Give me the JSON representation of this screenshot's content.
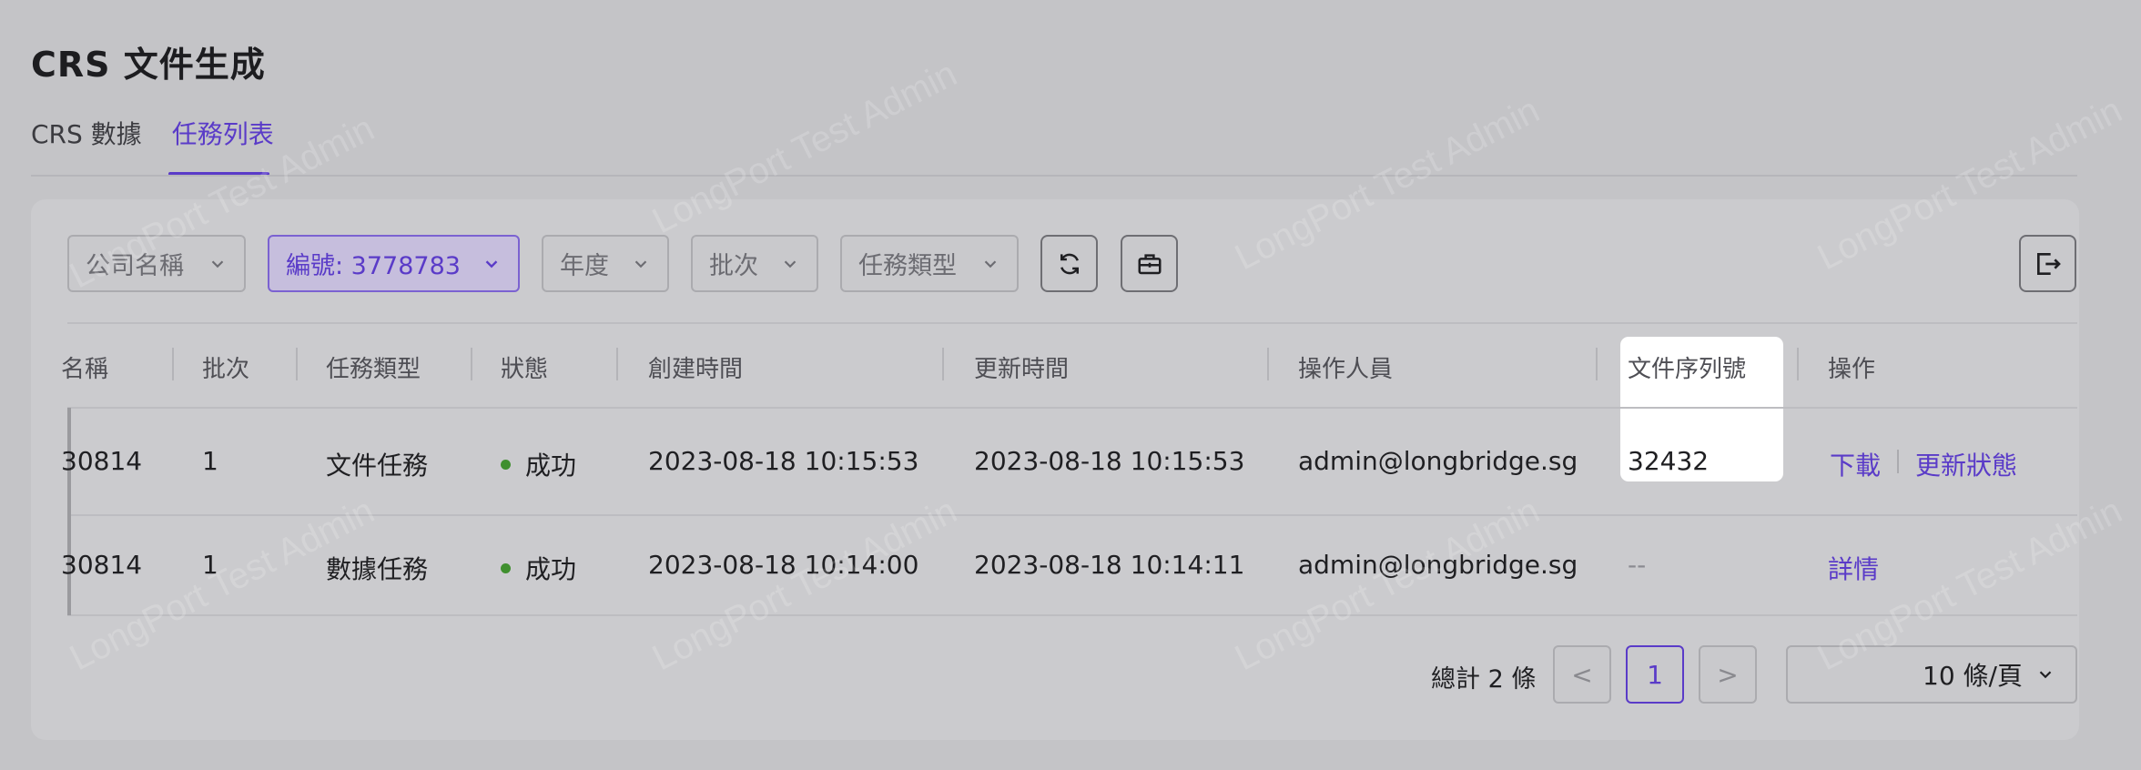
{
  "page": {
    "title": "CRS 文件生成"
  },
  "tabs": [
    {
      "label": "CRS 數據"
    },
    {
      "label": "任務列表"
    }
  ],
  "filters": {
    "company": "公司名稱",
    "number": "編號: 3778783",
    "year": "年度",
    "batch": "批次",
    "task_type": "任務類型"
  },
  "table": {
    "columns": [
      "名稱",
      "批次",
      "任務類型",
      "狀態",
      "創建時間",
      "更新時間",
      "操作人員",
      "文件序列號",
      "操作"
    ],
    "rows": [
      {
        "name": "30814",
        "batch": "1",
        "task_type": "文件任務",
        "status": "成功",
        "created": "2023-08-18 10:15:53",
        "updated": "2023-08-18 10:15:53",
        "operator": "admin@longbridge.sg",
        "serial": "32432",
        "actions": [
          "下載",
          "更新狀態"
        ]
      },
      {
        "name": "30814",
        "batch": "1",
        "task_type": "數據任務",
        "status": "成功",
        "created": "2023-08-18 10:14:00",
        "updated": "2023-08-18 10:14:11",
        "operator": "admin@longbridge.sg",
        "serial": "--",
        "actions": [
          "詳情"
        ]
      }
    ]
  },
  "pagination": {
    "total": "總計 2 條",
    "current": "1",
    "prev": "<",
    "next": ">",
    "page_size": "10 條/頁"
  },
  "watermark": "LongPort Test Admin",
  "colors": {
    "accent": "#5a3bc8",
    "success": "#3f8f2e",
    "overlay": "#c4c4c7"
  }
}
